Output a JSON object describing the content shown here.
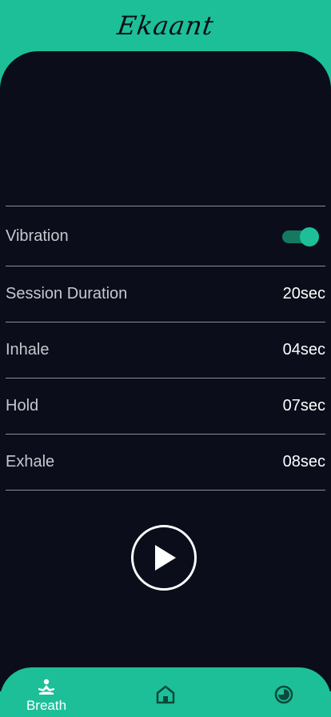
{
  "app": {
    "title": "Ekaant"
  },
  "settings": {
    "vibration": {
      "label": "Vibration",
      "enabled": true
    },
    "session_duration": {
      "label": "Session Duration",
      "value": "20sec"
    },
    "inhale": {
      "label": "Inhale",
      "value": "04sec"
    },
    "hold": {
      "label": "Hold",
      "value": "07sec"
    },
    "exhale": {
      "label": "Exhale",
      "value": "08sec"
    }
  },
  "controls": {
    "play_icon": "play-icon"
  },
  "nav": {
    "items": [
      {
        "label": "Breath",
        "icon": "meditation-icon",
        "active": true
      },
      {
        "label": "",
        "icon": "home-icon",
        "active": false
      },
      {
        "label": "",
        "icon": "stats-icon",
        "active": false
      }
    ]
  },
  "colors": {
    "accent": "#1DBF98",
    "background": "#0B0E1A",
    "divider": "#8A8E98"
  }
}
